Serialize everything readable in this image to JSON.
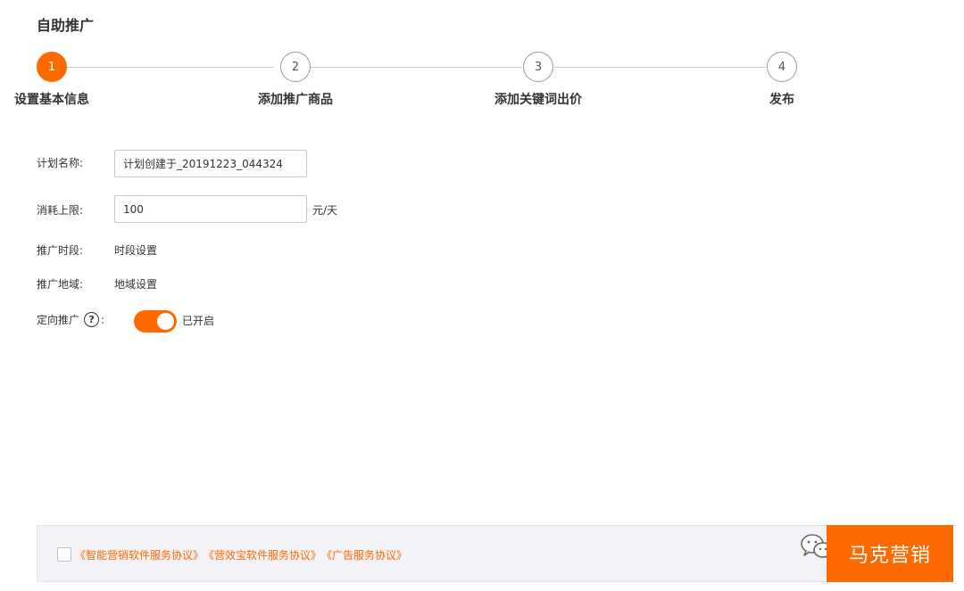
{
  "page": {
    "title": "自助推广"
  },
  "steps": [
    {
      "number": "1",
      "label": "设置基本信息"
    },
    {
      "number": "2",
      "label": "添加推广商品"
    },
    {
      "number": "3",
      "label": "添加关键词出价"
    },
    {
      "number": "4",
      "label": "发布"
    }
  ],
  "form": {
    "plan_name": {
      "label": "计划名称:",
      "value": "计划创建于_20191223_044324"
    },
    "budget": {
      "label": "消耗上限:",
      "value": "100",
      "unit": "元/天"
    },
    "time": {
      "label": "推广时段:",
      "link": "时段设置"
    },
    "region": {
      "label": "推广地域:",
      "link": "地域设置"
    },
    "targeting": {
      "label": "定向推广",
      "help": "?",
      "colon": ":",
      "status": "已开启"
    }
  },
  "footer": {
    "agreements": [
      "《智能营销软件服务协议》",
      "《营效宝软件服务协议》",
      "《广告服务协议》"
    ],
    "button_label": "马克营销"
  },
  "colors": {
    "accent": "#ff6a00"
  }
}
